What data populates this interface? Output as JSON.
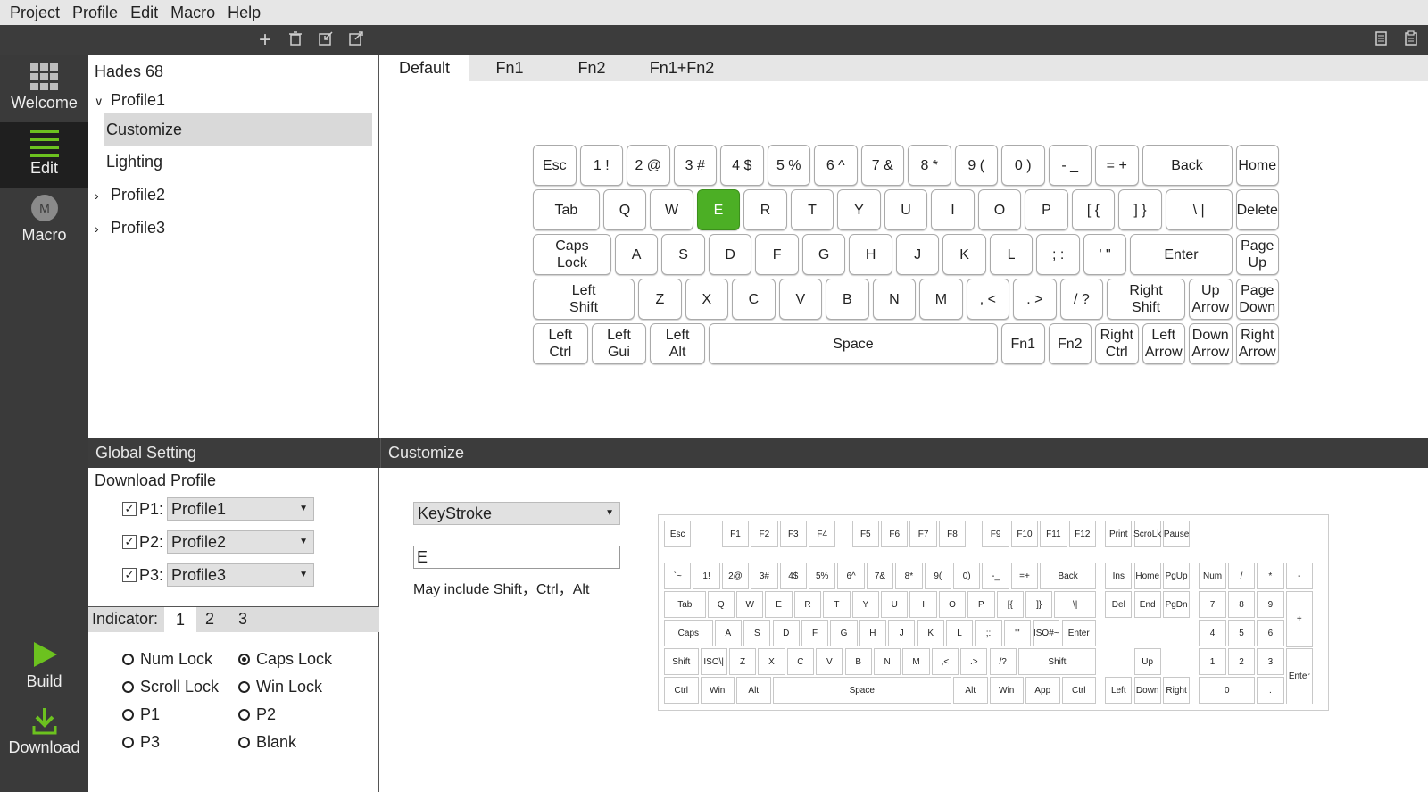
{
  "menu": [
    "Project",
    "Profile",
    "Edit",
    "Macro",
    "Help"
  ],
  "sidebar": {
    "welcome": "Welcome",
    "edit": "Edit",
    "macro": "Macro",
    "macro_badge": "M",
    "build": "Build",
    "download": "Download"
  },
  "tree": {
    "device": "Hades 68",
    "profile1": "Profile1",
    "customize": "Customize",
    "lighting": "Lighting",
    "profile2": "Profile2",
    "profile3": "Profile3"
  },
  "layer_tabs": [
    "Default",
    "Fn1",
    "Fn2",
    "Fn1+Fn2"
  ],
  "keyboard": [
    [
      "Esc",
      "1 !",
      "2 @",
      "3 #",
      "4 $",
      "5 %",
      "6 ^",
      "7 &",
      "8 *",
      "9 (",
      "0 )",
      "- _",
      "= +",
      "Back",
      "Home"
    ],
    [
      "Tab",
      "Q",
      "W",
      "E",
      "R",
      "T",
      "Y",
      "U",
      "I",
      "O",
      "P",
      "[ {",
      "] }",
      "\\ |",
      "Delete"
    ],
    [
      "Caps\nLock",
      "A",
      "S",
      "D",
      "F",
      "G",
      "H",
      "J",
      "K",
      "L",
      "; :",
      "' \"",
      "Enter",
      "Page\nUp"
    ],
    [
      "Left\nShift",
      "Z",
      "X",
      "C",
      "V",
      "B",
      "N",
      "M",
      ", <",
      ". >",
      "/ ?",
      "Right\nShift",
      "Up\nArrow",
      "Page\nDown"
    ],
    [
      "Left\nCtrl",
      "Left\nGui",
      "Left\nAlt",
      "Space",
      "Fn1",
      "Fn2",
      "Right\nCtrl",
      "Left\nArrow",
      "Down\nArrow",
      "Right\nArrow"
    ]
  ],
  "selected_key": "E",
  "global": {
    "header": "Global Setting",
    "download_profile": "Download Profile",
    "profiles": [
      {
        "label": "P1",
        "sep": ":",
        "value": "Profile1"
      },
      {
        "label": "P2",
        "sep": ":",
        "value": "Profile2"
      },
      {
        "label": "P3",
        "sep": ":",
        "value": "Profile3"
      }
    ],
    "indicator_label": "Indicator:",
    "indicator_tabs": [
      "1",
      "2",
      "3"
    ],
    "radios": [
      {
        "label": "Num Lock",
        "on": false
      },
      {
        "label": "Caps Lock",
        "on": true
      },
      {
        "label": "Scroll Lock",
        "on": false
      },
      {
        "label": "Win Lock",
        "on": false
      },
      {
        "label": "P1",
        "on": false
      },
      {
        "label": "P2",
        "on": false
      },
      {
        "label": "P3",
        "on": false
      },
      {
        "label": "Blank",
        "on": false
      }
    ]
  },
  "customize": {
    "header": "Customize",
    "mode": "KeyStroke",
    "key_value": "E",
    "hint": "May include Shift，Ctrl，Alt"
  },
  "ref_keyboard": {
    "row0": [
      "Esc",
      "F1",
      "F2",
      "F3",
      "F4",
      "F5",
      "F6",
      "F7",
      "F8",
      "F9",
      "F10",
      "F11",
      "F12",
      "Print",
      "ScroLk",
      "Pause"
    ],
    "row1": [
      "`~",
      "1!",
      "2@",
      "3#",
      "4$",
      "5%",
      "6^",
      "7&",
      "8*",
      "9(",
      "0)",
      "-_",
      "=+",
      "Back",
      "Ins",
      "Home",
      "PgUp",
      "Num",
      "/",
      "*",
      "-"
    ],
    "row2": [
      "Tab",
      "Q",
      "W",
      "E",
      "R",
      "T",
      "Y",
      "U",
      "I",
      "O",
      "P",
      "[{",
      "]}",
      "\\|",
      "Del",
      "End",
      "PgDn",
      "7",
      "8",
      "9",
      "+"
    ],
    "row3": [
      "Caps",
      "A",
      "S",
      "D",
      "F",
      "G",
      "H",
      "J",
      "K",
      "L",
      ";:",
      "'\"",
      "ISO#~",
      "Enter",
      "4",
      "5",
      "6"
    ],
    "row4": [
      "Shift",
      "ISO\\|",
      "Z",
      "X",
      "C",
      "V",
      "B",
      "N",
      "M",
      ",<",
      ".>",
      "/?",
      "Shift",
      "Up",
      "1",
      "2",
      "3",
      "Enter"
    ],
    "row5": [
      "Ctrl",
      "Win",
      "Alt",
      "Space",
      "Alt",
      "Win",
      "App",
      "Ctrl",
      "Left",
      "Down",
      "Right",
      "0",
      "."
    ]
  }
}
